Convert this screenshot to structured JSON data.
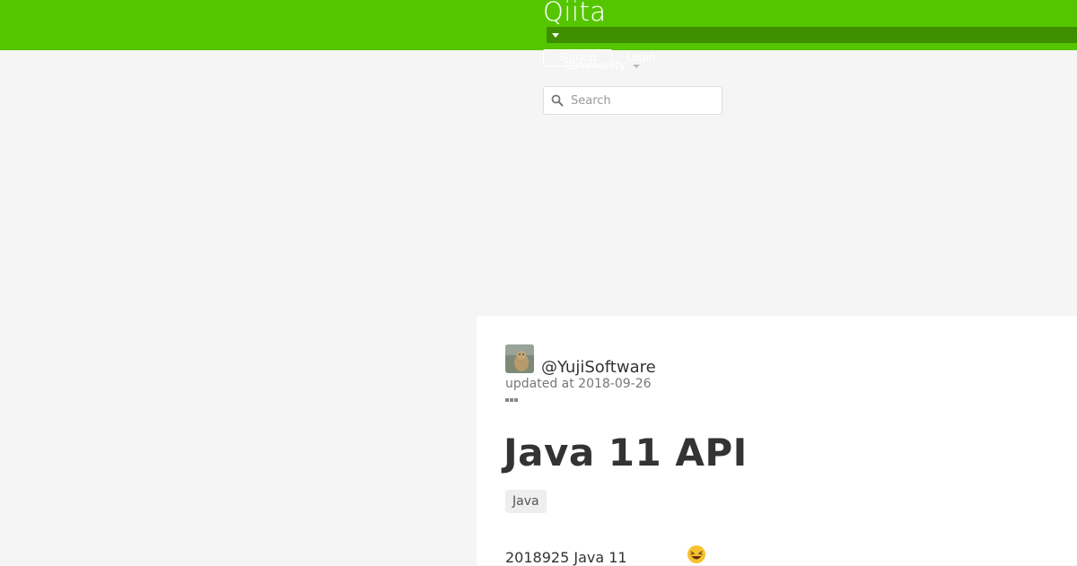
{
  "header": {
    "logo": "Qiita",
    "signup_label": "Signup",
    "login_label": "Login",
    "community_label": "Community",
    "brand_color": "#55c500"
  },
  "search": {
    "placeholder": "Search",
    "value": ""
  },
  "article": {
    "author": "@YujiSoftware",
    "updated": "updated at 2018-09-26",
    "title": "Java 11 API",
    "tags": [
      "Java"
    ],
    "intro_text": "2018925 Java 11",
    "emoji": "laughing-emoji"
  }
}
